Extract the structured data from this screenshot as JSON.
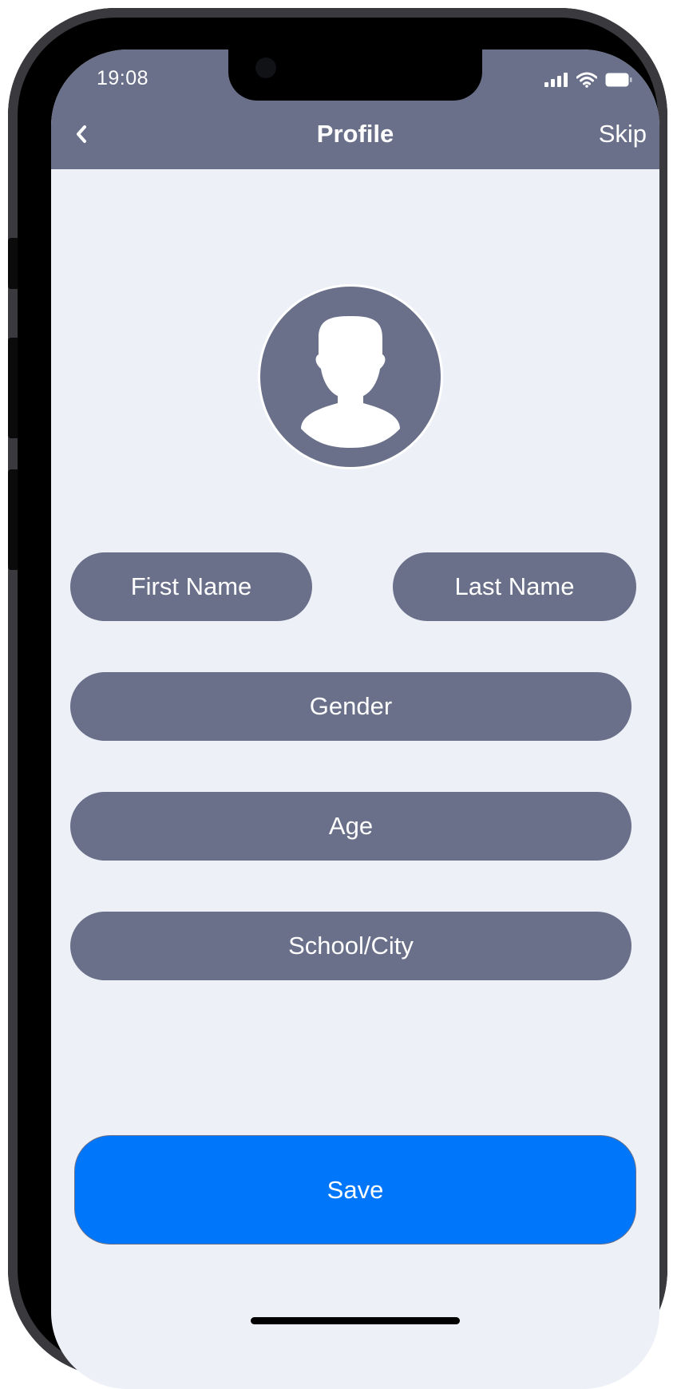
{
  "status_bar": {
    "time": "19:08",
    "icons": [
      "signal-icon",
      "wifi-icon",
      "battery-icon"
    ]
  },
  "nav": {
    "back_icon": "chevron-left-icon",
    "title": "Profile",
    "skip_label": "Skip"
  },
  "avatar": {
    "icon": "user-silhouette-icon"
  },
  "form": {
    "first_name_placeholder": "First Name",
    "last_name_placeholder": "Last Name",
    "gender_placeholder": "Gender",
    "age_placeholder": "Age",
    "school_city_placeholder": "School/City"
  },
  "save_button": {
    "label": "Save"
  },
  "colors": {
    "header": "#6a7089",
    "field": "#6a7089",
    "background": "#edf0f7",
    "primary": "#0077fb",
    "text_on_dark": "#ffffff"
  }
}
